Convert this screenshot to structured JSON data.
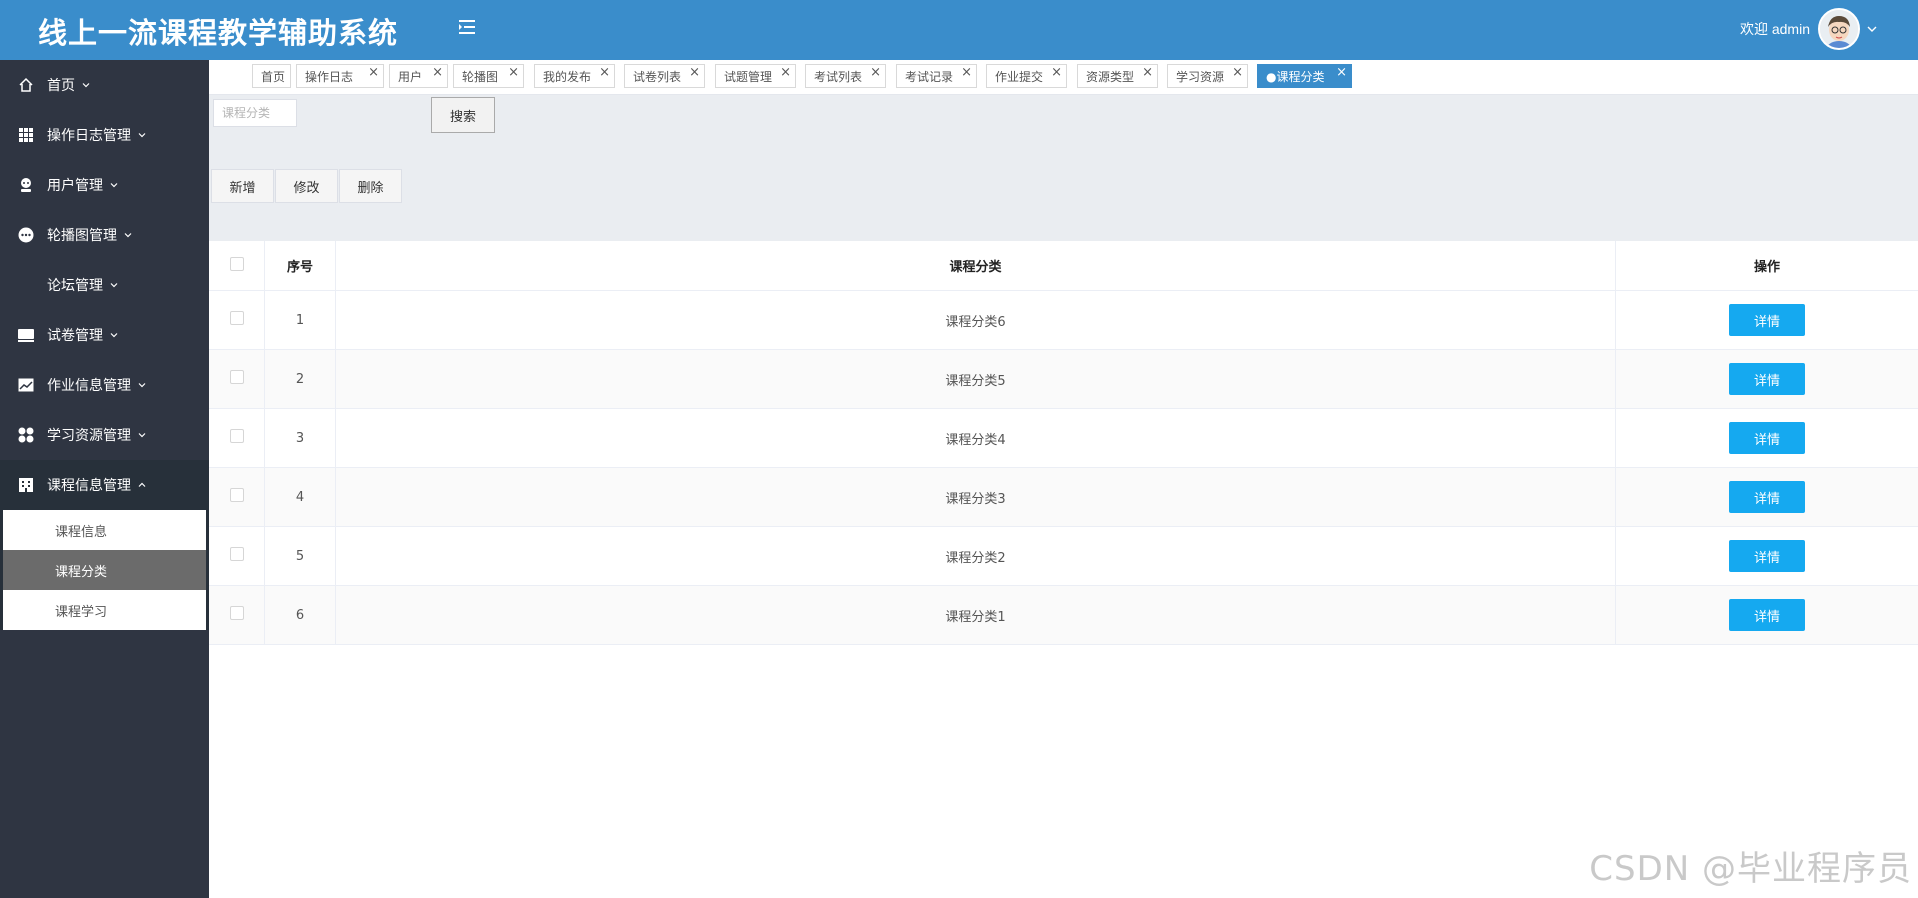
{
  "header": {
    "title": "线上一流课程教学辅助系统",
    "welcome": "欢迎 admin"
  },
  "sidebar": {
    "items": [
      {
        "label": "首页",
        "icon": "home-icon"
      },
      {
        "label": "操作日志管理",
        "icon": "grid-icon"
      },
      {
        "label": "用户管理",
        "icon": "user-icon"
      },
      {
        "label": "轮播图管理",
        "icon": "more-circle-icon"
      },
      {
        "label": "论坛管理",
        "icon": ""
      },
      {
        "label": "试卷管理",
        "icon": "monitor-icon"
      },
      {
        "label": "作业信息管理",
        "icon": "picture-icon"
      },
      {
        "label": "学习资源管理",
        "icon": "apps-icon"
      },
      {
        "label": "课程信息管理",
        "icon": "building-icon"
      }
    ],
    "submenu": [
      {
        "label": "课程信息"
      },
      {
        "label": "课程分类"
      },
      {
        "label": "课程学习"
      }
    ]
  },
  "tabs": [
    {
      "label": "首页"
    },
    {
      "label": "操作日志"
    },
    {
      "label": "用户"
    },
    {
      "label": "轮播图"
    },
    {
      "label": "我的发布"
    },
    {
      "label": "试卷列表"
    },
    {
      "label": "试题管理"
    },
    {
      "label": "考试列表"
    },
    {
      "label": "考试记录"
    },
    {
      "label": "作业提交"
    },
    {
      "label": "资源类型"
    },
    {
      "label": "学习资源"
    },
    {
      "label": "●课程分类"
    }
  ],
  "search": {
    "placeholder": "课程分类",
    "button": "搜索"
  },
  "actions": {
    "add": "新增",
    "edit": "修改",
    "delete": "删除"
  },
  "table": {
    "headers": {
      "no": "序号",
      "category": "课程分类",
      "op": "操作"
    },
    "rows": [
      {
        "no": "1",
        "category": "课程分类6",
        "op": "详情"
      },
      {
        "no": "2",
        "category": "课程分类5",
        "op": "详情"
      },
      {
        "no": "3",
        "category": "课程分类4",
        "op": "详情"
      },
      {
        "no": "4",
        "category": "课程分类3",
        "op": "详情"
      },
      {
        "no": "5",
        "category": "课程分类2",
        "op": "详情"
      },
      {
        "no": "6",
        "category": "课程分类1",
        "op": "详情"
      }
    ]
  },
  "watermark": "CSDN @毕业程序员",
  "colors": {
    "header": "#3a8dcb",
    "sidebar": "#2f3542",
    "detail_button": "#15a9f0",
    "active_tab": "#3a8dcb"
  }
}
